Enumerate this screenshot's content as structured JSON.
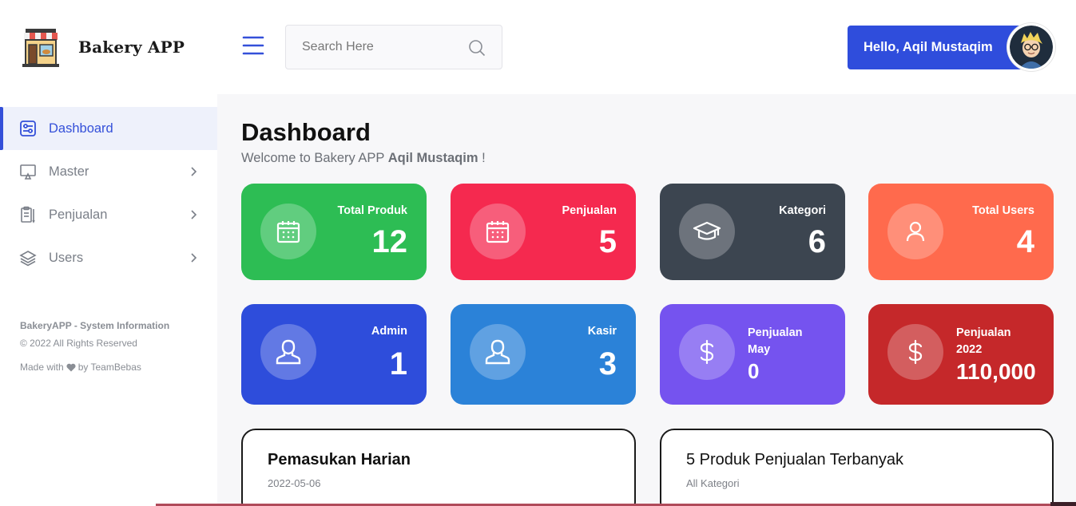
{
  "brand": {
    "name": "Bakery APP",
    "logo_icon": "bakery-shop-icon"
  },
  "sidebar": {
    "items": [
      {
        "label": "Dashboard",
        "icon": "dashboard-icon",
        "active": true,
        "has_submenu": false
      },
      {
        "label": "Master",
        "icon": "monitor-icon",
        "active": false,
        "has_submenu": true
      },
      {
        "label": "Penjualan",
        "icon": "clipboard-icon",
        "active": false,
        "has_submenu": true
      },
      {
        "label": "Users",
        "icon": "layers-icon",
        "active": false,
        "has_submenu": true
      }
    ],
    "system_info": {
      "title": "BakeryAPP - System Information",
      "copyright": "© 2022 All Rights Reserved",
      "made_with_prefix": "Made with",
      "made_with_suffix": "by TeamBebas"
    }
  },
  "header": {
    "search_placeholder": "Search Here",
    "greeting": "Hello, Aqil Mustaqim"
  },
  "main": {
    "title": "Dashboard",
    "welcome_prefix": "Welcome to Bakery APP",
    "welcome_name": "Aqil Mustaqim",
    "welcome_suffix": "!"
  },
  "stats": [
    {
      "label": "Total Produk",
      "value": "12",
      "color": "#2dbd54",
      "icon": "calendar-icon"
    },
    {
      "label": "Penjualan",
      "value": "5",
      "color": "#f5294f",
      "icon": "calendar-icon"
    },
    {
      "label": "Kategori",
      "value": "6",
      "color": "#3c4550",
      "icon": "graduation-cap-icon"
    },
    {
      "label": "Total Users",
      "value": "4",
      "color": "#ff6a4d",
      "icon": "user-icon"
    },
    {
      "label": "Admin",
      "value": "1",
      "color": "#2e4ddb",
      "icon": "user-outline-icon"
    },
    {
      "label": "Kasir",
      "value": "3",
      "color": "#2b82d8",
      "icon": "user-outline-icon"
    },
    {
      "label": "Penjualan",
      "label2": "May",
      "value": "0",
      "color": "#7553ef",
      "icon": "dollar-icon"
    },
    {
      "label": "Penjualan",
      "label2": "2022",
      "value": "110,000",
      "color": "#c5282a",
      "icon": "dollar-icon"
    }
  ],
  "panels": {
    "income": {
      "title": "Pemasukan Harian",
      "subtitle": "2022-05-06"
    },
    "top_products": {
      "title": "5 Produk Penjualan Terbanyak",
      "subtitle": "All Kategori"
    }
  }
}
